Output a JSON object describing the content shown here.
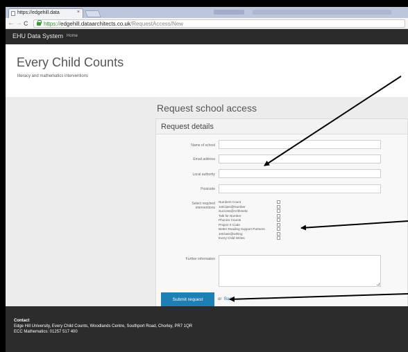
{
  "browser": {
    "tab_title": "https://edgehill.data",
    "tab_close": "×",
    "back_glyph": "←",
    "forward_glyph": "→",
    "reload_glyph": "C",
    "url_scheme": "https://",
    "url_domain": "edgehill.dataarchitects.co.uk",
    "url_path": "/RequestAccess/New"
  },
  "navbar": {
    "brand": "EHU Data System",
    "home_link": "Home"
  },
  "header": {
    "title": "Every Child Counts",
    "subtitle": "literacy and mathematics interventions"
  },
  "page": {
    "heading": "Request school access"
  },
  "form": {
    "panel_title": "Request details",
    "fields": {
      "school_label": "Name of school",
      "email_label": "Email address",
      "authority_label": "Local authority",
      "postcode_label": "Postcode",
      "interventions_label_1": "Select required",
      "interventions_label_2": "interventions",
      "further_label": "Further information"
    },
    "interventions": [
      "Numbers Count",
      "1stClass@Number",
      "Success@Arithmetic",
      "Talk for Number",
      "Phonics Counts",
      "Project X Code",
      "Better Reading Support Partners",
      "1stclass@writing",
      "Every Child Writes"
    ],
    "submit_label": "Submit request",
    "or_text": "or",
    "back_label": "Back"
  },
  "footer": {
    "title": "Contact",
    "address": "Edge Hill University, Every Child Counts, Woodlands Centre, Southport Road, Chorley, PR7 1QR",
    "phone": "ECC Mathematics: 01257 517 400"
  },
  "colors": {
    "primary_button": "#1d7fb3",
    "link": "#2a77b8",
    "navbar_bg": "#2a2a2a",
    "footer_bg": "#2c2c2c"
  }
}
